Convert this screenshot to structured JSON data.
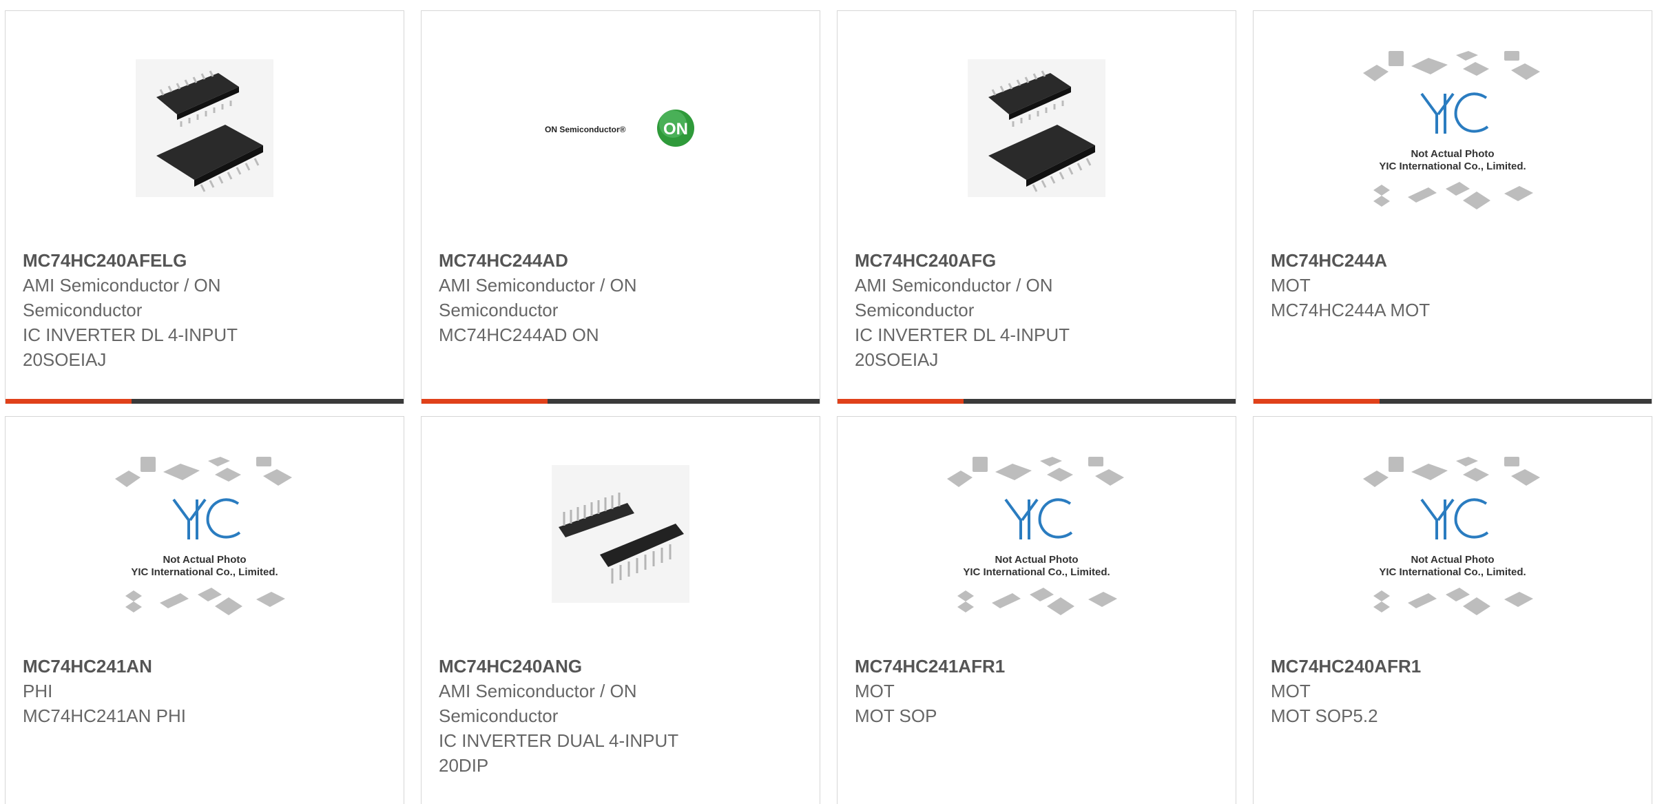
{
  "colors": {
    "accent": "#e0411a",
    "bar": "#3a3a3a",
    "part_text": "#555555",
    "desc_text": "#666666",
    "yic_blue": "#2a7cc0",
    "on_green": "#2f9a3a"
  },
  "products": [
    {
      "part": "MC74HC240AFELG",
      "lines": [
        "AMI Semiconductor / ON",
        "Semiconductor",
        "IC INVERTER DL 4-INPUT",
        "20SOEIAJ"
      ],
      "image": "soic-chip-photo"
    },
    {
      "part": "MC74HC244AD",
      "lines": [
        "AMI Semiconductor / ON",
        "Semiconductor",
        "MC74HC244AD ON"
      ],
      "image": "on-semiconductor-logo",
      "logo_text": "ON Semiconductor®",
      "logo_badge": "ON"
    },
    {
      "part": "MC74HC240AFG",
      "lines": [
        "AMI Semiconductor / ON",
        "Semiconductor",
        "IC INVERTER DL 4-INPUT",
        "20SOEIAJ"
      ],
      "image": "soic-chip-photo"
    },
    {
      "part": "MC74HC244A",
      "lines": [
        "MOT",
        "MC74HC244A MOT"
      ],
      "image": "yic-placeholder",
      "note1": "Not Actual Photo",
      "note2": "YIC International Co., Limited."
    },
    {
      "part": "MC74HC241AN",
      "lines": [
        "PHI",
        "MC74HC241AN PHI"
      ],
      "image": "yic-placeholder",
      "note1": "Not Actual Photo",
      "note2": "YIC International Co., Limited."
    },
    {
      "part": "MC74HC240ANG",
      "lines": [
        "AMI Semiconductor / ON",
        "Semiconductor",
        "IC INVERTER DUAL 4-INPUT",
        "20DIP"
      ],
      "image": "dip-chip-photo"
    },
    {
      "part": "MC74HC241AFR1",
      "lines": [
        "MOT",
        "MOT SOP"
      ],
      "image": "yic-placeholder",
      "note1": "Not Actual Photo",
      "note2": "YIC International Co., Limited."
    },
    {
      "part": "MC74HC240AFR1",
      "lines": [
        "MOT",
        "MOT SOP5.2"
      ],
      "image": "yic-placeholder",
      "note1": "Not Actual Photo",
      "note2": "YIC International Co., Limited."
    }
  ]
}
